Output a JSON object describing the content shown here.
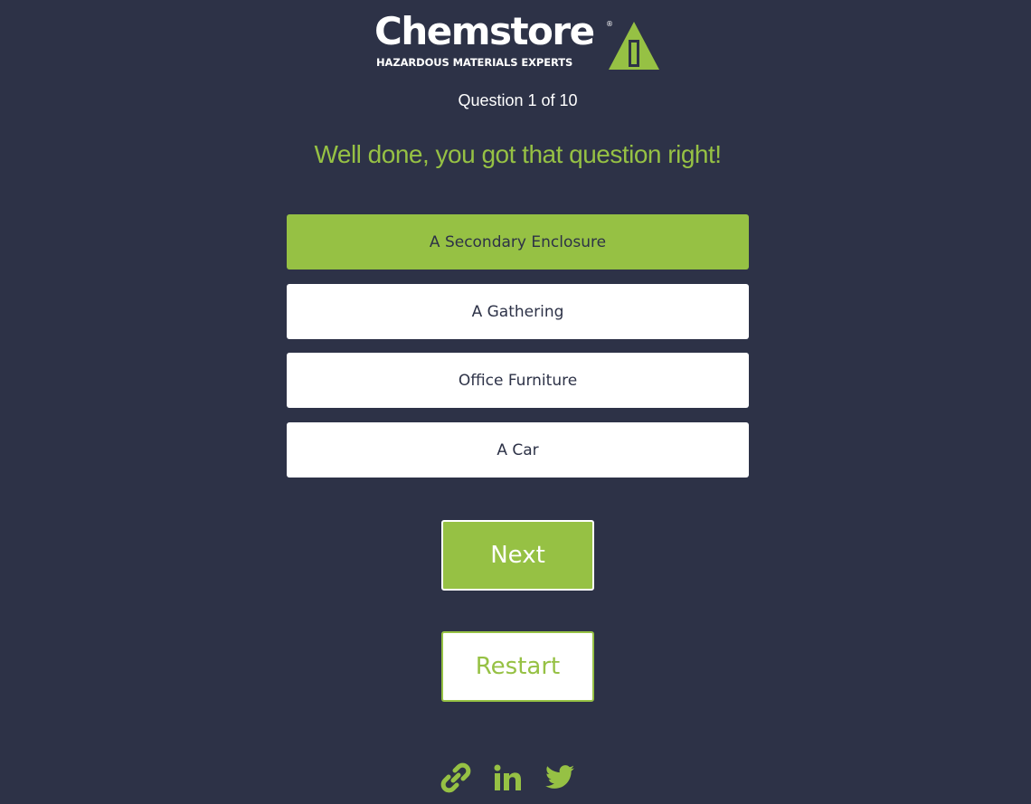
{
  "logo": {
    "wordmark": "Chemstore",
    "registered": "®",
    "tagline": "HAZARDOUS MATERIALS EXPERTS",
    "icon": "warning-triangle-icon"
  },
  "quiz": {
    "progress": "Question 1 of 10",
    "current_question": 1,
    "total_questions": 10,
    "feedback": "Well done, you got that question right!",
    "answers": [
      {
        "label": "A Secondary Enclosure",
        "state": "correct"
      },
      {
        "label": "A Gathering",
        "state": "default"
      },
      {
        "label": "Office Furniture",
        "state": "default"
      },
      {
        "label": "A Car",
        "state": "default"
      }
    ],
    "next_label": "Next",
    "restart_label": "Restart"
  },
  "social": [
    {
      "icon": "link-icon"
    },
    {
      "icon": "linkedin-icon"
    },
    {
      "icon": "twitter-icon"
    }
  ],
  "colors": {
    "background": "#2d3247",
    "accent": "#96c144",
    "white": "#ffffff"
  }
}
